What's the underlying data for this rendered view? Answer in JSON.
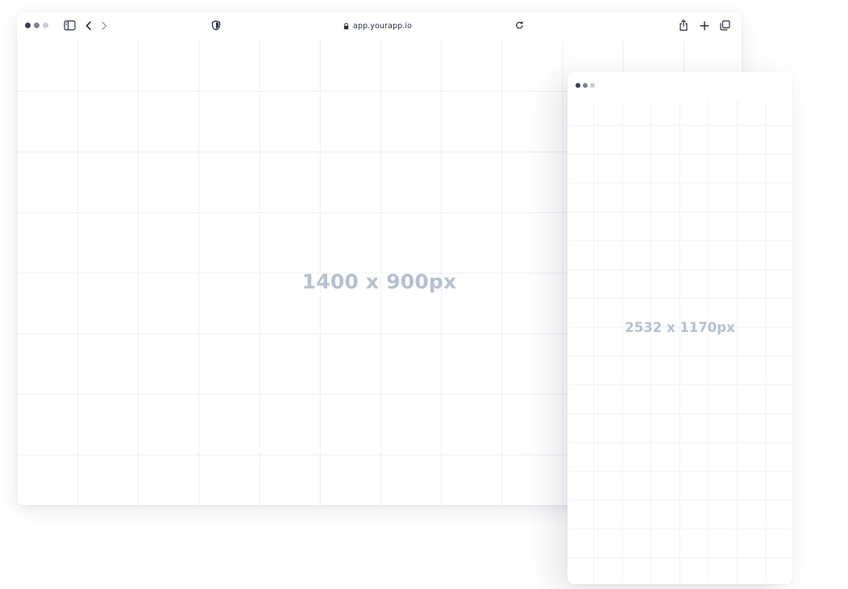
{
  "browser": {
    "url": "app.yourapp.io",
    "dots": [
      "#3a3f52",
      "#7d8291",
      "#c9ccd3"
    ],
    "toolbar_icons": [
      "sidebar-icon",
      "chevron-left-icon",
      "chevron-right-icon",
      "shield-icon",
      "lock-icon",
      "reload-icon",
      "share-icon",
      "plus-icon",
      "tabs-icon"
    ],
    "canvas_label": "1400 x 900px"
  },
  "phone": {
    "dots": [
      "#3a3f52",
      "#7d8291",
      "#c9ccd3"
    ],
    "canvas_label": "2532 x 1170px"
  },
  "colors": {
    "label": "#b6c0cf",
    "grid": "#eceef2",
    "icon": "#2a2f45"
  }
}
